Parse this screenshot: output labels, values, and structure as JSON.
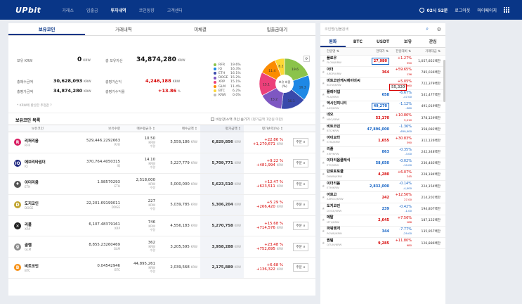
{
  "header": {
    "logo": "UPbit",
    "nav": [
      "거래소",
      "입출금",
      "투자내역",
      "코인동향",
      "고객센터"
    ],
    "active_nav": 2,
    "clock": "02시 52분",
    "login": "로그아웃",
    "mypage": "마이페이지"
  },
  "main_tabs": [
    "보유코인",
    "거래내역",
    "미체결",
    "입출금대기"
  ],
  "summary": {
    "krw_label": "보유 KRW",
    "krw": "0",
    "total_label": "총 보유자산",
    "total": "34,874,280",
    "buy_label": "총매수금액",
    "buy": "30,628,093",
    "pnl_label": "총평가손익",
    "pnl": "4,246,188",
    "eval_label": "총평가금액",
    "eval": "34,874,280",
    "rate_label": "총평가수익률",
    "rate": "+13.86",
    "rate_unit": "%",
    "unit_krw": "KRW",
    "orderable_note": "* KRW에 환산한 추정값 ?",
    "pie_center": "보유 비중\n(%)"
  },
  "chart_data": {
    "type": "pie",
    "categories": [
      "RFR",
      "IQ",
      "ETH",
      "DOGE",
      "XRP",
      "GLM",
      "BTC",
      "KRW"
    ],
    "values": [
      19.6,
      16.3,
      16.1,
      15.2,
      15.1,
      11.4,
      6.2,
      0.0
    ],
    "colors": [
      "#8bc34a",
      "#1e88e5",
      "#3949ab",
      "#7e57c2",
      "#ec407a",
      "#fb8c00",
      "#fdd835",
      "#bdbdbd"
    ],
    "pie_labels": [
      "19.6",
      "16.3",
      "16.1",
      "15.2",
      "15.1",
      "11.4",
      "6.2",
      ""
    ]
  },
  "list": {
    "title": "보유코인 목록",
    "hide_small": "비상장/소액 코인 숨기기",
    "hide_note": "(평가금액 1만원 미만)",
    "headers": [
      "보유코인",
      "보유수량",
      "매수평균가 ↕",
      "매수금액 ↕",
      "평가금액 ↕",
      "평가손익(%) ↕",
      ""
    ],
    "rows": [
      {
        "name": "리퍼리움",
        "sym": "RFR",
        "qty": "529,446.2292663",
        "qsym": "RFR",
        "avg": "10.50",
        "buy": "5,559,186",
        "eval": "6,829,856",
        "pct": "+22.86",
        "pnl": "+1,270,671",
        "color": "#d81b60",
        "glyph": "R"
      },
      {
        "name": "에브리타임더",
        "sym": "IQ",
        "qty": "370,764.4050315",
        "qsym": "IQ",
        "avg": "14.10",
        "buy": "5,227,779",
        "eval": "5,709,771",
        "pct": "+9.22",
        "pnl": "+481,994",
        "color": "#1a237e",
        "glyph": "IQ"
      },
      {
        "name": "이더리움",
        "sym": "ETH",
        "qty": "1.98570293",
        "qsym": "ETH",
        "avg": "2,518,000",
        "buy": "5,000,000",
        "eval": "5,623,510",
        "pct": "+12.47",
        "pnl": "+623,511",
        "color": "#555555",
        "glyph": "♦"
      },
      {
        "name": "도지코인",
        "sym": "DOGE",
        "qty": "22,201.69199011",
        "qsym": "DOGE",
        "avg": "227",
        "buy": "5,039,785",
        "eval": "5,306,204",
        "pct": "+5.29",
        "pnl": "+266,420",
        "color": "#c2a633",
        "glyph": "D"
      },
      {
        "name": "리플",
        "sym": "XRP",
        "qty": "6,107.48379161",
        "qsym": "XRP",
        "avg": "746",
        "buy": "4,556,183",
        "eval": "5,270,758",
        "pct": "+15.68",
        "pnl": "+714,576",
        "color": "#222222",
        "glyph": "✕"
      },
      {
        "name": "골렘",
        "sym": "GLM",
        "qty": "8,855.23260469",
        "qsym": "GLM",
        "avg": "362",
        "buy": "3,205,595",
        "eval": "3,958,288",
        "pct": "+23.48",
        "pnl": "+752,695",
        "color": "#8d8d8d",
        "glyph": "g"
      },
      {
        "name": "비트코인",
        "sym": "BTC",
        "qty": "0.04542946",
        "qsym": "BTC",
        "avg": "44,895,261",
        "buy": "2,039,568",
        "eval": "2,175,889",
        "pct": "+6.68",
        "pnl": "+136,322",
        "color": "#f7931a",
        "glyph": "B"
      }
    ],
    "unit_krw": "KRW",
    "unit_small": "수량",
    "order_btn": "주문 ∨"
  },
  "side": {
    "search_placeholder": "코인명/심볼검색",
    "tabs": [
      "원화",
      "BTC",
      "USDT",
      "보유",
      "관심"
    ],
    "headers": [
      "한글명 ⇅",
      "현재가 ⇅",
      "전일대비 ⇅",
      "거래대금 ⇅"
    ],
    "rows": [
      {
        "n": "플로우",
        "s": "FLOW/KRW",
        "p": "27,980",
        "c": "+1.27%",
        "d": "350",
        "v": "1,057,851백만",
        "up": true,
        "box": "blue"
      },
      {
        "n": "아더",
        "s": "ARDR/KRW",
        "p": "364",
        "c": "+59.65%",
        "d": "136",
        "v": "785,036백만",
        "up": true,
        "box": ""
      },
      {
        "n": "비트코인캐시에이비씨",
        "s": "BCHA/KRW",
        "p": "55,320",
        "c": "+5.05%",
        "d": "2,660",
        "v": "722,379백만",
        "up": true,
        "box": "red"
      },
      {
        "n": "플레이댑",
        "s": "PLA/KRW",
        "p": "658",
        "c": "-6.67%",
        "d": "-47.00",
        "v": "541,477백만",
        "up": false,
        "box": ""
      },
      {
        "n": "엑시인피니티",
        "s": "AXS/KRW",
        "p": "49,270",
        "c": "-1.12%",
        "d": "-560",
        "v": "491,019백만",
        "up": false,
        "box": "blue"
      },
      {
        "n": "네오",
        "s": "NEO/KRW",
        "p": "53,170",
        "c": "+10.86%",
        "d": "5,210",
        "v": "378,129백만",
        "up": true,
        "box": ""
      },
      {
        "n": "비트코인",
        "s": "BTC/KRW",
        "p": "47,896,000",
        "c": "-1.36%",
        "d": "-659,000",
        "v": "358,082백만",
        "up": false,
        "box": ""
      },
      {
        "n": "아이오타",
        "s": "IOTA/KRW",
        "p": "1,655",
        "c": "+30.83%",
        "d": "390",
        "v": "312,126백만",
        "up": true,
        "box": ""
      },
      {
        "n": "리플",
        "s": "XRP/KRW",
        "p": "863",
        "c": "-0.35%",
        "d": "-3.00",
        "v": "242,348백만",
        "up": false,
        "box": ""
      },
      {
        "n": "이더리움클래식",
        "s": "ETC/KRW",
        "p": "58,650",
        "c": "-0.02%",
        "d": "-10.00",
        "v": "230,483백만",
        "up": false,
        "box": ""
      },
      {
        "n": "단로토토클",
        "s": "DAWN/KRW",
        "p": "4,280",
        "c": "+6.07%",
        "d": "245",
        "v": "228,184백만",
        "up": true,
        "box": ""
      },
      {
        "n": "이더리움",
        "s": "ETH/KRW",
        "p": "2,832,000",
        "c": "-0.14%",
        "d": "-4,000",
        "v": "224,154백만",
        "up": false,
        "box": ""
      },
      {
        "n": "아르고",
        "s": "AERGO/KRW",
        "p": "242",
        "c": "+12.56%",
        "d": "27.00",
        "v": "214,201백만",
        "up": true,
        "box": ""
      },
      {
        "n": "도지코인",
        "s": "DOGE/KRW",
        "p": "239",
        "c": "-0.42%",
        "d": "-1.00",
        "v": "194,807백만",
        "up": false,
        "box": ""
      },
      {
        "n": "메탈",
        "s": "MTL/KRW",
        "p": "2,645",
        "c": "+7.56%",
        "d": "186",
        "v": "187,122백만",
        "up": true,
        "box": ""
      },
      {
        "n": "파워렛저",
        "s": "POWR/KRW",
        "p": "344",
        "c": "-7.77%",
        "d": "-29.00",
        "v": "135,957백만",
        "up": false,
        "box": ""
      },
      {
        "n": "퀀텀",
        "s": "QTUM/KRW",
        "p": "9,285",
        "c": "+11.80%",
        "d": "980",
        "v": "126,886백만",
        "up": true,
        "box": ""
      }
    ]
  }
}
